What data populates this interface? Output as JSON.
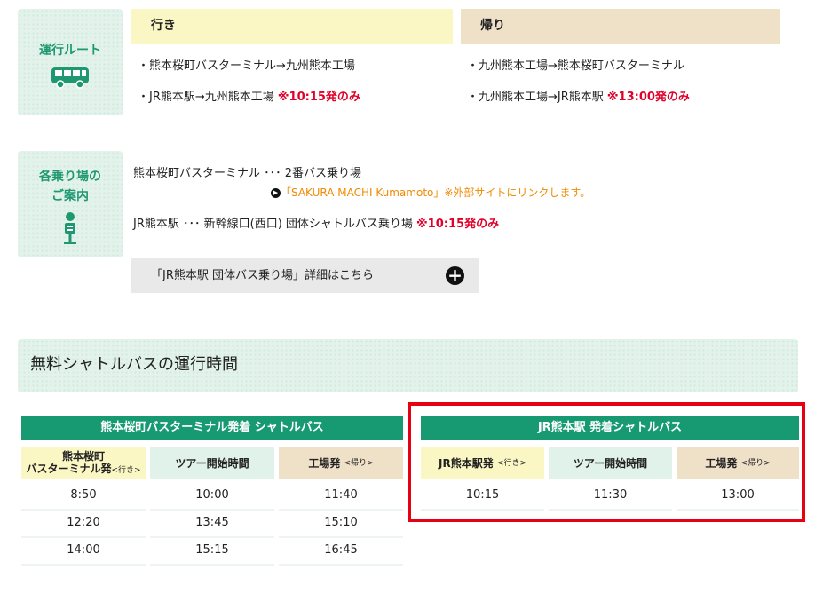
{
  "route": {
    "label": "運行ルート",
    "outbound_header": "行き",
    "return_header": "帰り",
    "outbound": [
      {
        "text": "・熊本桜町バスターミナル→九州熊本工場",
        "note": ""
      },
      {
        "text": "・JR熊本駅→九州熊本工場 ",
        "note": "※10:15発のみ"
      }
    ],
    "return": [
      {
        "text": "・九州熊本工場→熊本桜町バスターミナル",
        "note": ""
      },
      {
        "text": "・九州熊本工場→JR熊本駅 ",
        "note": "※13:00発のみ"
      }
    ]
  },
  "stops": {
    "label_line1": "各乗り場の",
    "label_line2": "ご案内",
    "line1": "熊本桜町バスターミナル ･･･ 2番バス乗り場",
    "link_text": "「SAKURA MACHI Kumamoto」",
    "link_suffix": "※外部サイトにリンクします。",
    "line2_text": "JR熊本駅 ･･･ 新幹線口(西口) 団体シャトルバス乗り場 ",
    "line2_note": "※10:15発のみ",
    "detail_button": "「JR熊本駅 団体バス乗り場」詳細はこちら"
  },
  "schedule_title": "無料シャトルバスの運行時間",
  "table_sakura": {
    "title": "熊本桜町バスターミナル発着 シャトルバス",
    "col1_line1": "熊本桜町",
    "col1_line2": "バスターミナル発",
    "col1_small": "<行き>",
    "col2": "ツアー開始時間",
    "col3": "工場発",
    "col3_small": "<帰り>",
    "rows": [
      [
        "8:50",
        "10:00",
        "11:40"
      ],
      [
        "12:20",
        "13:45",
        "15:10"
      ],
      [
        "14:00",
        "15:15",
        "16:45"
      ]
    ]
  },
  "table_jr": {
    "title": "JR熊本駅 発着シャトルバス",
    "col1": "JR熊本駅発",
    "col1_small": "<行き>",
    "col2": "ツアー開始時間",
    "col3": "工場発",
    "col3_small": "<帰り>",
    "rows": [
      [
        "10:15",
        "11:30",
        "13:00"
      ]
    ],
    "highlight_color": "#e60012"
  },
  "colors": {
    "accent_green": "#179a72",
    "note_red": "#e0002a",
    "link_orange": "#f08a00"
  }
}
